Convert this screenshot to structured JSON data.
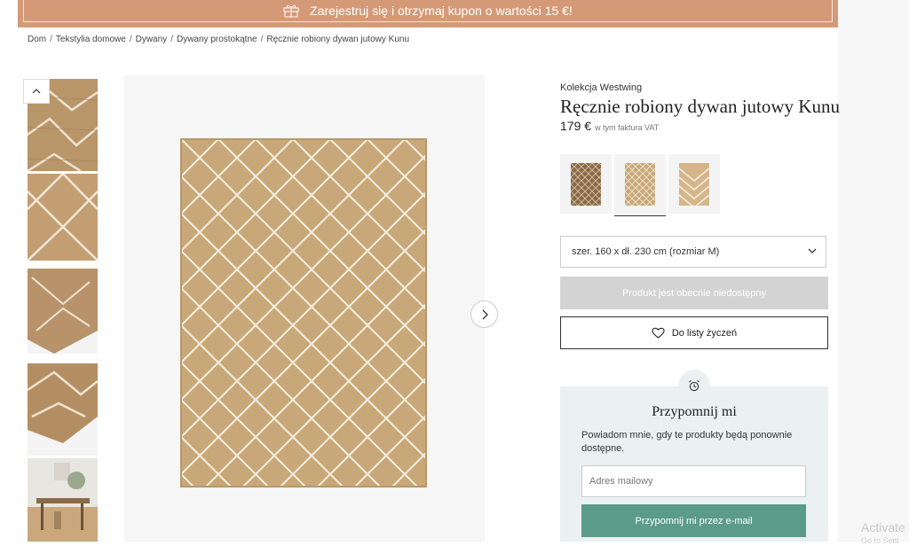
{
  "promo": {
    "text": "Zarejestruj się i otrzymaj kupon o wartości 15 €!",
    "icon": "gift-icon"
  },
  "breadcrumb": [
    "Dom",
    "Tekstylia domowe",
    "Dywany",
    "Dywany prostokątne",
    "Ręcznie robiony dywan jutowy Kunu"
  ],
  "product": {
    "brand": "Kolekcja Westwing",
    "title": "Ręcznie robiony dywan jutowy Kunu",
    "price": "179 €",
    "vat_note": "w tym faktura VAT"
  },
  "variants": [
    {
      "name": "dark-diamond",
      "active": false
    },
    {
      "name": "kunu",
      "active": true
    },
    {
      "name": "chevron",
      "active": false
    }
  ],
  "size_select": {
    "value": "szer. 160 x dł. 230 cm (rozmiar M)"
  },
  "buttons": {
    "unavailable": "Produkt jest obecnie niedostępny",
    "wishlist": "Do listy życzeń",
    "remind_submit": "Przypomnij mi przez e-mail"
  },
  "remind": {
    "title": "Przypomnij mi",
    "text": "Powiadom mnie, gdy te produkty będą ponownie dostępne.",
    "email_placeholder": "Adres mailowy"
  },
  "os_overlay": {
    "line1": "Activate",
    "line2": "Go to Setti"
  },
  "colors": {
    "promo_bg": "#d49a78",
    "remind_bg": "#ebf1f1",
    "remind_button": "#5b9c89",
    "jute": "#c8a878"
  }
}
